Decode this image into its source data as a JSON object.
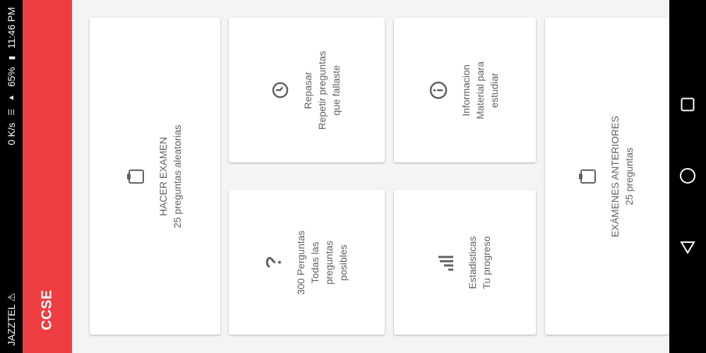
{
  "status_bar": {
    "carrier": "JAZZTEL",
    "speed": "0 K/s",
    "battery": "65%",
    "time": "11:46 PM"
  },
  "app_bar": {
    "title": "CCSE"
  },
  "cards": {
    "exam": {
      "title": "HACER EXAMEN",
      "subtitle": "25 preguntas aleatorias",
      "icon": "clipboard-icon"
    },
    "review": {
      "title": "Repasar",
      "subtitle_1": "Repetir preguntas",
      "subtitle_2": "que fallaste",
      "icon": "review-clock-icon"
    },
    "questions": {
      "title": "300 Perguntas",
      "subtitle_1": "Todas las",
      "subtitle_2": "preguntas",
      "subtitle_3": "posibles",
      "icon": "question-icon"
    },
    "info": {
      "title": "Informacion",
      "subtitle_1": "Material para",
      "subtitle_2": "estudiar",
      "icon": "info-icon"
    },
    "stats": {
      "title": "Estadisticas",
      "subtitle": "Tu progreso",
      "icon": "bar-chart-icon"
    },
    "past": {
      "title": "EXÁMENES ANTERIORES",
      "subtitle": "25 preguntas",
      "icon": "clipboard-icon"
    }
  },
  "nav_bar": {
    "recent_icon": "square-icon",
    "home_icon": "circle-icon",
    "back_icon": "triangle-icon"
  }
}
